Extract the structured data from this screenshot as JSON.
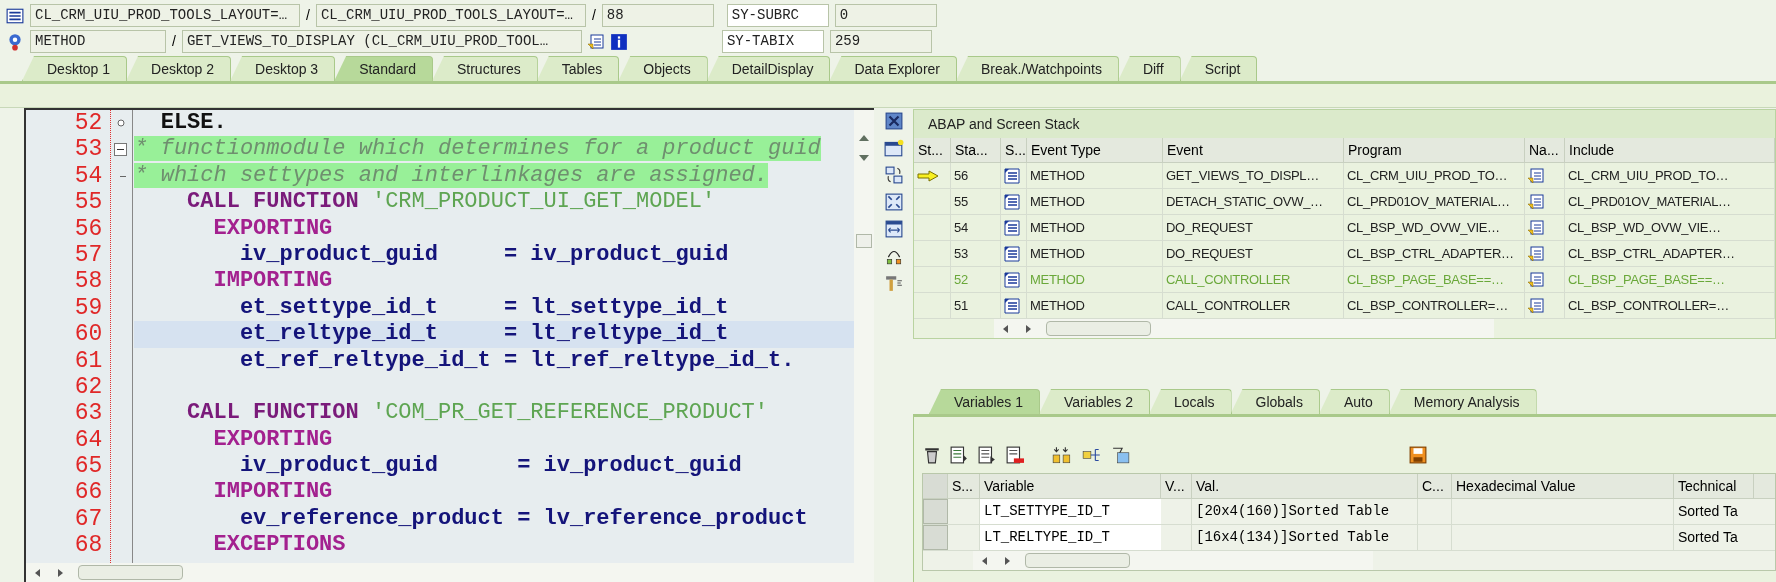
{
  "header": {
    "row1": {
      "fields": [
        "CL_CRM_UIU_PROD_TOOLS_LAYOUT=…",
        "CL_CRM_UIU_PROD_TOOLS_LAYOUT=…",
        "88"
      ],
      "separators": [
        "/",
        "/"
      ],
      "sy_label": "SY-SUBRC",
      "sy_value": "0"
    },
    "row2": {
      "fields": [
        "METHOD",
        "GET_VIEWS_TO_DISPLAY (CL_CRM_UIU_PROD_TOOL…"
      ],
      "separators": [
        "/"
      ],
      "sy_label": "SY-TABIX",
      "sy_value": "259"
    }
  },
  "tabs": [
    {
      "label": "Desktop 1",
      "selected": false
    },
    {
      "label": "Desktop 2",
      "selected": false
    },
    {
      "label": "Desktop 3",
      "selected": false
    },
    {
      "label": "Standard",
      "selected": true
    },
    {
      "label": "Structures",
      "selected": false
    },
    {
      "label": "Tables",
      "selected": false
    },
    {
      "label": "Objects",
      "selected": false
    },
    {
      "label": "DetailDisplay",
      "selected": false
    },
    {
      "label": "Data Explorer",
      "selected": false
    },
    {
      "label": "Break./Watchpoints",
      "selected": false
    },
    {
      "label": "Diff",
      "selected": false
    },
    {
      "label": "Script",
      "selected": false
    }
  ],
  "editor": {
    "lines": [
      {
        "number": "52",
        "kind": "branch",
        "current": false,
        "tokens": [
          {
            "kind": "plain",
            "text": "  ELSE."
          }
        ]
      },
      {
        "number": "53",
        "kind": "collapse",
        "current": false,
        "tokens": [
          {
            "kind": "comment",
            "text": "* functionmodule which determines for a product guid"
          }
        ]
      },
      {
        "number": "54",
        "kind": "end",
        "current": false,
        "tokens": [
          {
            "kind": "comment",
            "text": "* which settypes and interlinkages are assigned."
          }
        ]
      },
      {
        "number": "55",
        "current": false,
        "tokens": [
          {
            "kind": "keyword",
            "text": "    CALL FUNCTION"
          },
          {
            "kind": "string",
            "text": " 'CRM_PRODUCT_UI_GET_MODEL'"
          }
        ]
      },
      {
        "number": "56",
        "current": false,
        "tokens": [
          {
            "kind": "keyword2",
            "text": "      EXPORTING"
          }
        ]
      },
      {
        "number": "57",
        "current": false,
        "tokens": [
          {
            "kind": "identifier",
            "text": "        iv_product_guid     = iv_product_guid"
          }
        ]
      },
      {
        "number": "58",
        "current": false,
        "tokens": [
          {
            "kind": "keyword2",
            "text": "      IMPORTING"
          }
        ]
      },
      {
        "number": "59",
        "current": false,
        "tokens": [
          {
            "kind": "identifier",
            "text": "        et_settype_id_t     = lt_settype_id_t"
          }
        ]
      },
      {
        "number": "60",
        "current": true,
        "tokens": [
          {
            "kind": "identifier",
            "text": "        et_reltype_id_t     = lt_reltype_id_t"
          }
        ]
      },
      {
        "number": "61",
        "current": false,
        "tokens": [
          {
            "kind": "identifier",
            "text": "        et_ref_reltype_id_t = lt_ref_reltype_id_t."
          }
        ]
      },
      {
        "number": "62",
        "current": false
      },
      {
        "number": "63",
        "current": false,
        "tokens": [
          {
            "kind": "keyword",
            "text": "    CALL FUNCTION"
          },
          {
            "kind": "string",
            "text": " 'COM_PR_GET_REFERENCE_PRODUCT'"
          }
        ]
      },
      {
        "number": "64",
        "current": false,
        "tokens": [
          {
            "kind": "keyword2",
            "text": "      EXPORTING"
          }
        ]
      },
      {
        "number": "65",
        "current": false,
        "tokens": [
          {
            "kind": "identifier",
            "text": "        iv_product_guid      = iv_product_guid"
          }
        ]
      },
      {
        "number": "66",
        "current": false,
        "tokens": [
          {
            "kind": "keyword2",
            "text": "      IMPORTING"
          }
        ]
      },
      {
        "number": "67",
        "current": false,
        "tokens": [
          {
            "kind": "identifier",
            "text": "        ev_reference_product = lv_reference_product"
          }
        ]
      },
      {
        "number": "68",
        "current": false,
        "tokens": [
          {
            "kind": "keyword2",
            "text": "      EXCEPTIONS"
          }
        ]
      }
    ]
  },
  "stack": {
    "title": "ABAP and Screen Stack",
    "columns": [
      "St...",
      "Sta...",
      "S...",
      "Event Type",
      "Event",
      "Program",
      "Na...",
      "Include"
    ],
    "rows": [
      {
        "current": true,
        "highlighted": false,
        "level": "56",
        "event_type": "METHOD",
        "event": "GET_VIEWS_TO_DISPL…",
        "program": "CL_CRM_UIU_PROD_TO…",
        "include": "CL_CRM_UIU_PROD_TO…"
      },
      {
        "current": false,
        "highlighted": false,
        "level": "55",
        "event_type": "METHOD",
        "event": "DETACH_STATIC_OVW_…",
        "program": "CL_PRD01OV_MATERIAL…",
        "include": "CL_PRD01OV_MATERIAL…"
      },
      {
        "current": false,
        "highlighted": false,
        "level": "54",
        "event_type": "METHOD",
        "event": "DO_REQUEST",
        "program": "CL_BSP_WD_OVW_VIE…",
        "include": "CL_BSP_WD_OVW_VIE…"
      },
      {
        "current": false,
        "highlighted": false,
        "level": "53",
        "event_type": "METHOD",
        "event": "DO_REQUEST",
        "program": "CL_BSP_CTRL_ADAPTER…",
        "include": "CL_BSP_CTRL_ADAPTER…"
      },
      {
        "current": false,
        "highlighted": true,
        "level": "52",
        "event_type": "METHOD",
        "event": "CALL_CONTROLLER",
        "program": "CL_BSP_PAGE_BASE==…",
        "include": "CL_BSP_PAGE_BASE==…"
      },
      {
        "current": false,
        "highlighted": false,
        "level": "51",
        "event_type": "METHOD",
        "event": "CALL_CONTROLLER",
        "program": "CL_BSP_CONTROLLER=…",
        "include": "CL_BSP_CONTROLLER=…"
      }
    ]
  },
  "variables": {
    "tabs": [
      {
        "label": "Variables 1",
        "selected": true
      },
      {
        "label": "Variables 2",
        "selected": false
      },
      {
        "label": "Locals",
        "selected": false
      },
      {
        "label": "Globals",
        "selected": false
      },
      {
        "label": "Auto",
        "selected": false
      },
      {
        "label": "Memory Analysis",
        "selected": false
      }
    ],
    "columns": [
      "S...",
      "Variable",
      "V...",
      "Val.",
      "C...",
      "Hexadecimal Value",
      "Technical"
    ],
    "rows": [
      {
        "variable": "LT_SETTYPE_ID_T",
        "value": "[20x4(160)]Sorted Table",
        "technical": "Sorted Ta"
      },
      {
        "variable": "LT_RELTYPE_ID_T",
        "value": "[16x4(134)]Sorted Table",
        "technical": "Sorted Ta"
      }
    ]
  }
}
